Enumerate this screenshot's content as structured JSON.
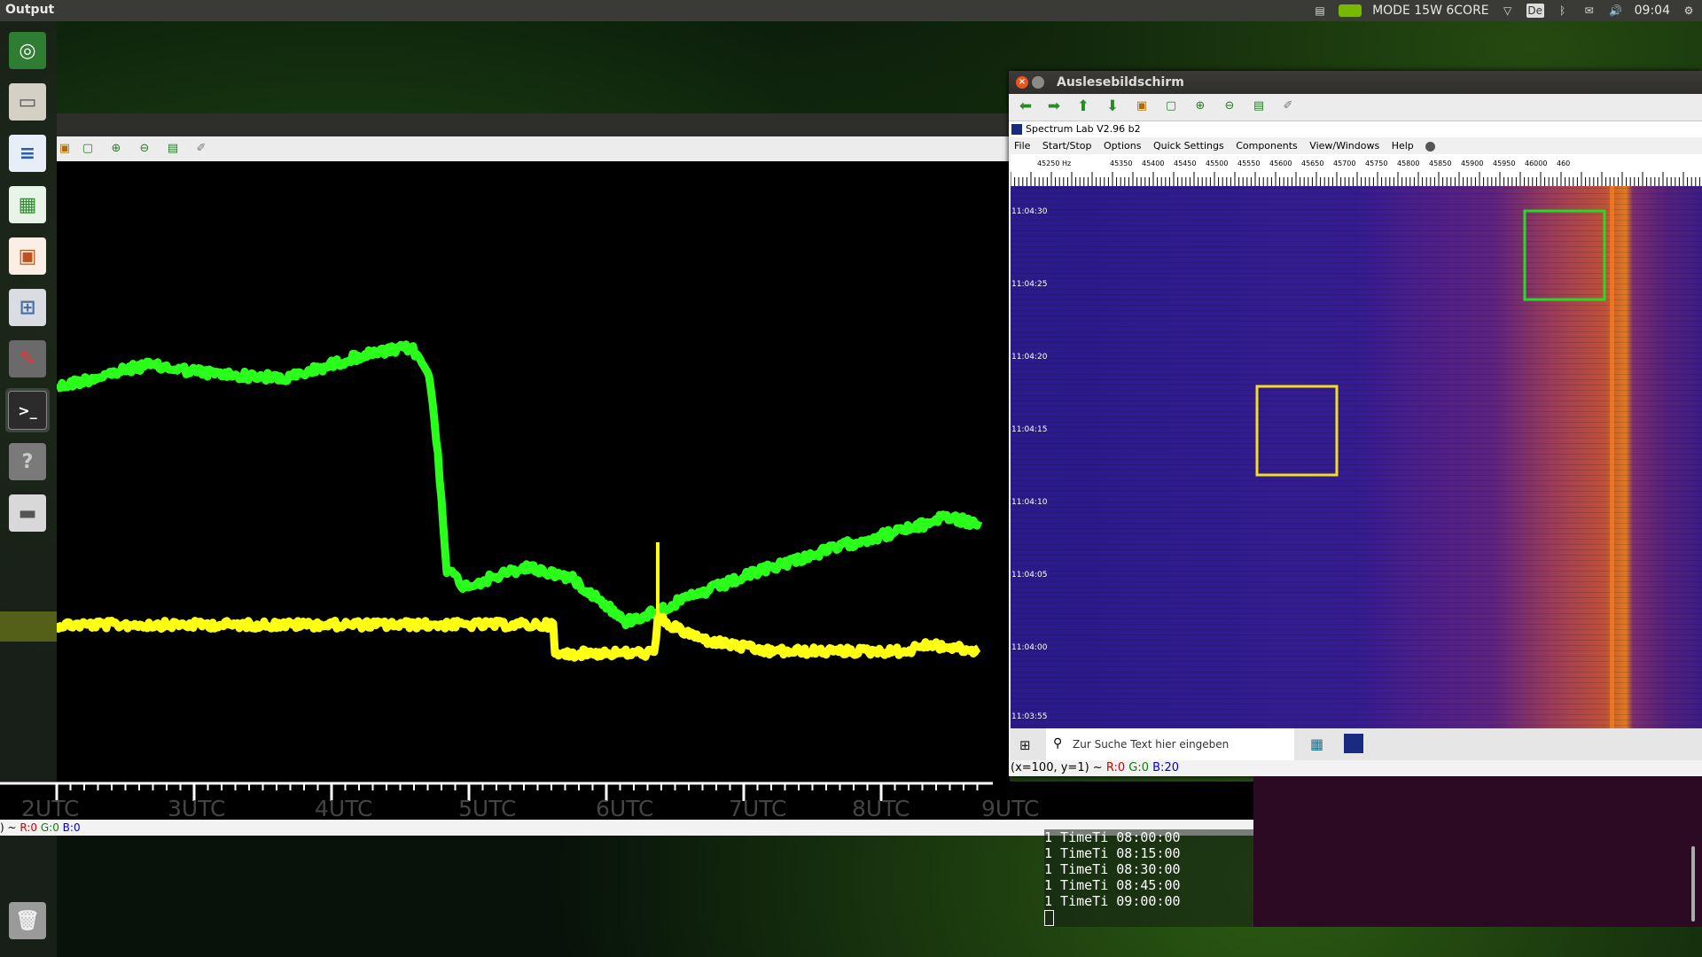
{
  "topbar": {
    "title": "Output",
    "mode": "MODE 15W 6CORE",
    "keyboard": "De",
    "clock": "09:04"
  },
  "launcher": {
    "items": [
      {
        "name": "ubuntu-logo-icon"
      },
      {
        "name": "file-manager-icon"
      },
      {
        "name": "writer-icon"
      },
      {
        "name": "calc-icon"
      },
      {
        "name": "impress-icon"
      },
      {
        "name": "software-center-icon"
      },
      {
        "name": "system-settings-icon"
      },
      {
        "name": "terminal-icon"
      },
      {
        "name": "help-icon"
      },
      {
        "name": "drive-icon"
      }
    ]
  },
  "graph": {
    "time_labels": [
      "2UTC",
      "3UTC",
      "4UTC",
      "5UTC",
      "6UTC",
      "7UTC",
      "8UTC",
      "9UTC"
    ],
    "status_prefix": ") ~ ",
    "status_r": "R:0",
    "status_g": "G:0",
    "status_b": "B:0"
  },
  "spectrum": {
    "window_title": "Auslesebildschirm",
    "app_title": "Spectrum Lab V2.96 b2",
    "menu": [
      "File",
      "Start/Stop",
      "Options",
      "Quick Settings",
      "Components",
      "View/Windows",
      "Help"
    ],
    "freq_labels": [
      "45250 Hz",
      "45350",
      "45400",
      "45450",
      "45500",
      "45550",
      "45600",
      "45650",
      "45700",
      "45750",
      "45800",
      "45850",
      "45900",
      "45950",
      "46000",
      "460"
    ],
    "time_labels": [
      "11:04:30",
      "11:04:25",
      "11:04:20",
      "11:04:15",
      "11:04:10",
      "11:04:05",
      "11:04:00",
      "11:03:55"
    ],
    "search_placeholder": "Zur Suche Text hier eingeben",
    "status_prefix": "(x=100, y=1) ~ ",
    "status_r": "R:0",
    "status_g": "G:0",
    "status_b": "B:20"
  },
  "terminal": {
    "lines": [
      "1 TimeTi  08:00:00",
      "1 TimeTi  08:15:00",
      "1 TimeTi  08:30:00",
      "1 TimeTi  08:45:00",
      "1 TimeTi  09:00:00"
    ]
  },
  "colors": {
    "green_trace": "#29ff1a",
    "yellow_trace": "#ffff14",
    "nvidia": "#76b900"
  }
}
